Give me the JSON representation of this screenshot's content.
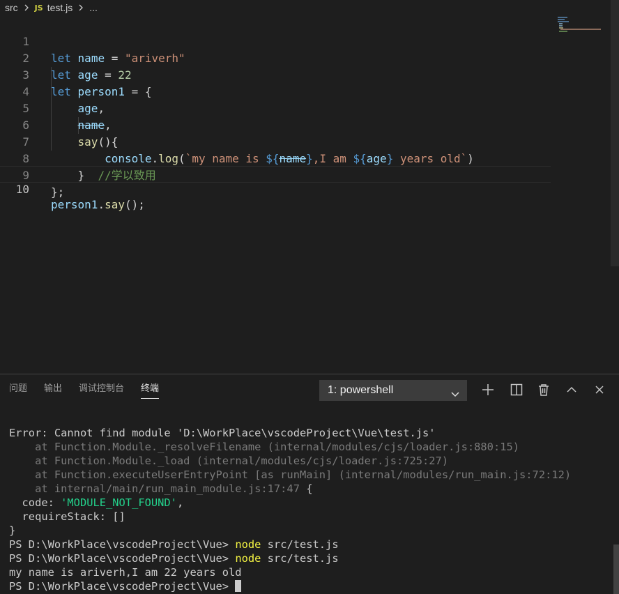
{
  "breadcrumb": {
    "folder": "src",
    "badge": "JS",
    "file": "test.js",
    "more": "..."
  },
  "editor": {
    "line_numbers": [
      "1",
      "2",
      "3",
      "4",
      "5",
      "6",
      "7",
      "8",
      "9",
      "10"
    ],
    "current_line": 10,
    "code": {
      "l1": {
        "kw": "let",
        "name": "name",
        "eq": " = ",
        "val": "\"ariverh\""
      },
      "l2": {
        "kw": "let",
        "name": "age",
        "eq": " = ",
        "val": "22"
      },
      "l3": {
        "kw": "let",
        "name": "person1",
        "rest": " = {"
      },
      "l4": {
        "name": "age",
        "rest": ","
      },
      "l5": {
        "name": "name",
        "rest": ","
      },
      "l6": {
        "fn": "say",
        "rest": "(){"
      },
      "l7": {
        "obj": "console",
        "dot": ".",
        "fn": "log",
        "open": "(",
        "s1": "`my name is ",
        "b1o": "${",
        "v1": "name",
        "b1c": "}",
        "s2": ",I am ",
        "b2o": "${",
        "v2": "age",
        "b2c": "}",
        "s3": " years old`",
        "close": ")"
      },
      "l8": {
        "brace": "}",
        "comment": "//学以致用"
      },
      "l9": {
        "text": "};"
      },
      "l10": {
        "obj": "person1",
        "dot": ".",
        "fn": "say",
        "rest": "();"
      }
    }
  },
  "panel": {
    "tabs": [
      "问题",
      "输出",
      "调试控制台",
      "终端"
    ],
    "active_tab": "终端",
    "terminal_select": "1: powershell",
    "icons": [
      "plus-icon",
      "split-icon",
      "trash-icon",
      "chevron-up-icon",
      "close-icon"
    ]
  },
  "terminal": {
    "err_label": "Error: ",
    "err_msg": "Cannot find module 'D:\\WorkPlace\\vscodeProject\\Vue\\test.js'",
    "at1_fn": "    at Function.Module._resolveFilename ",
    "at1_loc": "(internal/modules/cjs/loader.js:880:15)",
    "at2_fn": "    at Function.Module._load ",
    "at2_loc": "(internal/modules/cjs/loader.js:725:27)",
    "at3_fn": "    at Function.executeUserEntryPoint [as runMain] ",
    "at3_loc": "(internal/modules/run_main.js:72:12)",
    "at4": "    at internal/main/run_main_module.js:17:47 ",
    "at4_brace": "{",
    "code_key": "  code: ",
    "code_val": "'MODULE_NOT_FOUND'",
    "code_comma": ",",
    "req": "  requireStack: []",
    "close": "}",
    "prompt": "PS D:\\WorkPlace\\vscodeProject\\Vue> ",
    "cmd": "node",
    "arg": " src/test.js",
    "output": "my name is ariverh,I am 22 years old"
  },
  "colors": {
    "background": "#1e1e1e",
    "keyword": "#569cd6",
    "variable": "#9cdcfe",
    "function": "#dcdcaa",
    "string": "#ce9178",
    "comment": "#6a9955",
    "terminal_green": "#23d18b",
    "terminal_yellow": "#f5f543"
  }
}
